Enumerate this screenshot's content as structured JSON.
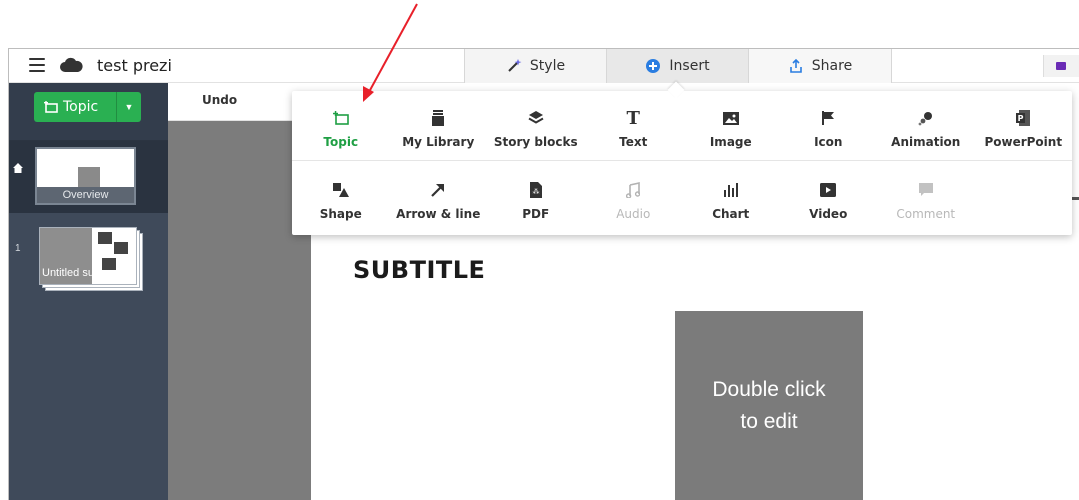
{
  "app": {
    "title": "test prezi"
  },
  "tabs": [
    {
      "label": "Style",
      "icon": "wand-icon"
    },
    {
      "label": "Insert",
      "icon": "plus-circle-icon"
    },
    {
      "label": "Share",
      "icon": "upload-icon"
    }
  ],
  "sidebar": {
    "topic_button": "Topic",
    "overview_label": "Overview",
    "slide_number": "1",
    "slide_label": "Untitled subtopic"
  },
  "toolbar": {
    "undo_label": "Undo"
  },
  "insert_menu": {
    "row1": [
      {
        "label": "Topic",
        "icon": "topic-icon",
        "state": "active"
      },
      {
        "label": "My Library",
        "icon": "library-icon",
        "state": "normal"
      },
      {
        "label": "Story blocks",
        "icon": "layers-icon",
        "state": "normal"
      },
      {
        "label": "Text",
        "icon": "text-icon",
        "state": "normal"
      },
      {
        "label": "Image",
        "icon": "image-icon",
        "state": "normal"
      },
      {
        "label": "Icon",
        "icon": "flag-icon",
        "state": "normal"
      },
      {
        "label": "Animation",
        "icon": "animation-icon",
        "state": "normal"
      },
      {
        "label": "PowerPoint",
        "icon": "powerpoint-icon",
        "state": "normal"
      }
    ],
    "row2": [
      {
        "label": "Shape",
        "icon": "shape-icon",
        "state": "normal"
      },
      {
        "label": "Arrow & line",
        "icon": "arrow-icon",
        "state": "normal"
      },
      {
        "label": "PDF",
        "icon": "pdf-icon",
        "state": "normal"
      },
      {
        "label": "Audio",
        "icon": "music-icon",
        "state": "disabled"
      },
      {
        "label": "Chart",
        "icon": "chart-icon",
        "state": "normal"
      },
      {
        "label": "Video",
        "icon": "video-icon",
        "state": "normal"
      },
      {
        "label": "Comment",
        "icon": "comment-icon",
        "state": "disabled"
      }
    ]
  },
  "canvas": {
    "subtitle": "SUBTITLE",
    "placeholder_text": "Double click\nto edit"
  },
  "colors": {
    "accent_green": "#2ab052",
    "sidebar_bg": "#3f4a5a",
    "annotation_red": "#e8202a",
    "insert_blue": "#2a7de1"
  }
}
